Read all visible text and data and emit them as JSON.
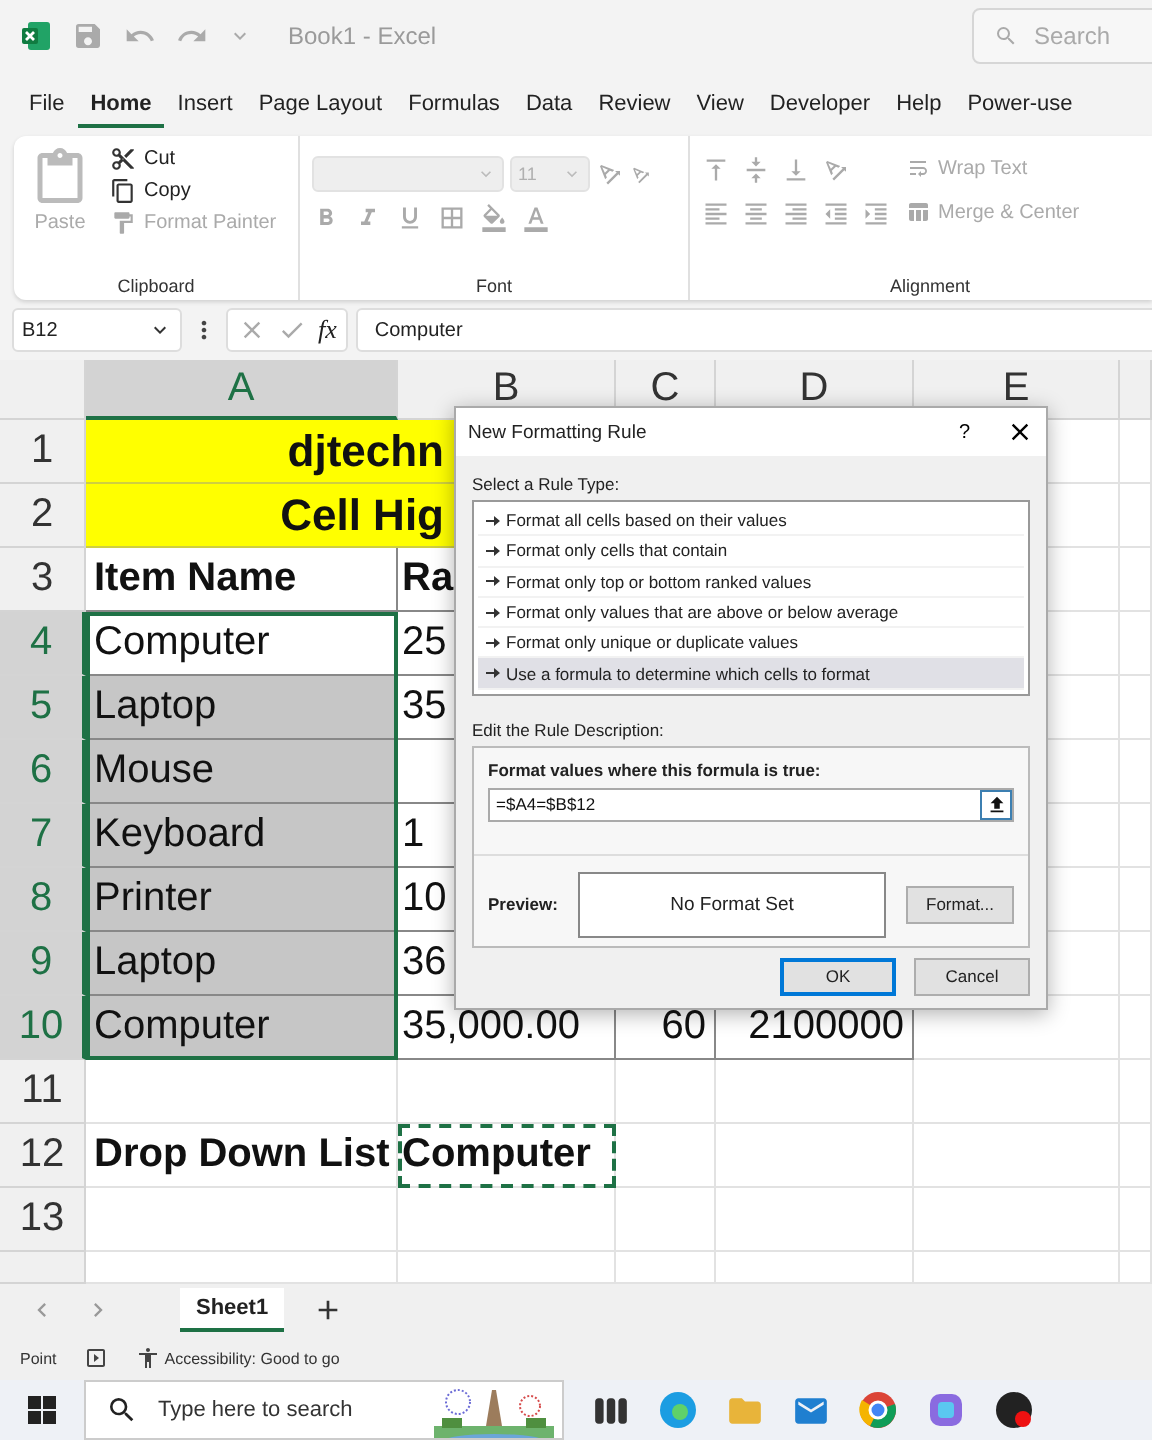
{
  "title_bar": {
    "title": "Book1  -  Excel",
    "search_placeholder": "Search"
  },
  "menu": [
    {
      "label": "File",
      "selected": false
    },
    {
      "label": "Home",
      "selected": true
    },
    {
      "label": "Insert",
      "selected": false
    },
    {
      "label": "Page Layout",
      "selected": false
    },
    {
      "label": "Formulas",
      "selected": false
    },
    {
      "label": "Data",
      "selected": false
    },
    {
      "label": "Review",
      "selected": false
    },
    {
      "label": "View",
      "selected": false
    },
    {
      "label": "Developer",
      "selected": false
    },
    {
      "label": "Help",
      "selected": false
    },
    {
      "label": "Power-use",
      "selected": false
    }
  ],
  "ribbon": {
    "clipboard": {
      "title": "Clipboard",
      "paste": {
        "label": "Paste",
        "disabled": true
      },
      "items": [
        {
          "label": "Cut",
          "disabled": false
        },
        {
          "label": "Copy",
          "disabled": false
        },
        {
          "label": "Format Painter",
          "disabled": true
        }
      ]
    },
    "font": {
      "title": "Font",
      "size": "11",
      "disabled": true
    },
    "alignment": {
      "title": "Alignment",
      "wrap_text": "Wrap Text",
      "merge_center": "Merge & Center",
      "disabled": true
    }
  },
  "formula_bar": {
    "name_box": "B12",
    "fx": "fx",
    "value": "Computer"
  },
  "grid": {
    "columns": [
      {
        "label": "A",
        "selected": true
      },
      {
        "label": "B",
        "selected": false
      },
      {
        "label": "C",
        "selected": false
      },
      {
        "label": "D",
        "selected": false
      },
      {
        "label": "E",
        "selected": false
      }
    ],
    "rows": [
      {
        "label": "1",
        "selected": false,
        "kind": "title",
        "a": {
          "text": "djtechn"
        }
      },
      {
        "label": "2",
        "selected": false,
        "kind": "title",
        "a": {
          "text": "Cell Hig"
        }
      },
      {
        "label": "3",
        "selected": false,
        "kind": "header",
        "a": {
          "text": "Item Name"
        },
        "b": {
          "text": "Ra"
        }
      },
      {
        "label": "4",
        "selected": true,
        "kind": "data",
        "a": {
          "text": "Computer",
          "highlighted": false
        },
        "b": {
          "text": "25"
        }
      },
      {
        "label": "5",
        "selected": true,
        "kind": "data",
        "a": {
          "text": "Laptop",
          "highlighted": true
        },
        "b": {
          "text": "35"
        }
      },
      {
        "label": "6",
        "selected": true,
        "kind": "data",
        "a": {
          "text": "Mouse",
          "highlighted": true
        }
      },
      {
        "label": "7",
        "selected": true,
        "kind": "data",
        "a": {
          "text": "Keyboard",
          "highlighted": true
        },
        "b": {
          "text": "1"
        }
      },
      {
        "label": "8",
        "selected": true,
        "kind": "data",
        "a": {
          "text": "Printer",
          "highlighted": true
        },
        "b": {
          "text": "10"
        }
      },
      {
        "label": "9",
        "selected": true,
        "kind": "data",
        "a": {
          "text": "Laptop",
          "highlighted": true
        },
        "b": {
          "text": "36"
        }
      },
      {
        "label": "10",
        "selected": true,
        "kind": "data",
        "a": {
          "text": "Computer",
          "highlighted": true
        },
        "b": {
          "text": "35,000.00"
        },
        "c": {
          "text": "60"
        },
        "d": {
          "text": "2100000"
        }
      },
      {
        "label": "11",
        "selected": false,
        "kind": "empty"
      },
      {
        "label": "12",
        "selected": false,
        "kind": "label",
        "a": {
          "text": "Drop Down List"
        },
        "b": {
          "text": "Computer",
          "copied": true
        }
      },
      {
        "label": "13",
        "selected": false,
        "kind": "empty"
      }
    ]
  },
  "dialog": {
    "title": "New Formatting Rule",
    "help": "?",
    "rule_type_label": "Select a Rule Type:",
    "rule_types": [
      {
        "label": "Format all cells based on their values",
        "selected": false
      },
      {
        "label": "Format only cells that contain",
        "selected": false
      },
      {
        "label": "Format only top or bottom ranked values",
        "selected": false
      },
      {
        "label": "Format only values that are above or below average",
        "selected": false
      },
      {
        "label": "Format only unique or duplicate values",
        "selected": false
      },
      {
        "label": "Use a formula to determine which cells to format",
        "selected": true
      }
    ],
    "description_label": "Edit the Rule Description:",
    "formula_label": "Format values where this formula is true:",
    "formula": "=$A4=$B$12",
    "preview_label": "Preview:",
    "preview": "No Format Set",
    "format_button": "Format...",
    "buttons": [
      {
        "label": "OK",
        "default": true
      },
      {
        "label": "Cancel",
        "default": false
      }
    ]
  },
  "sheet_tabs": [
    {
      "label": "Sheet1",
      "selected": true
    }
  ],
  "status_bar": {
    "mode": "Point",
    "accessibility": "Accessibility: Good to go"
  },
  "taskbar": {
    "search_placeholder": "Type here to search"
  }
}
